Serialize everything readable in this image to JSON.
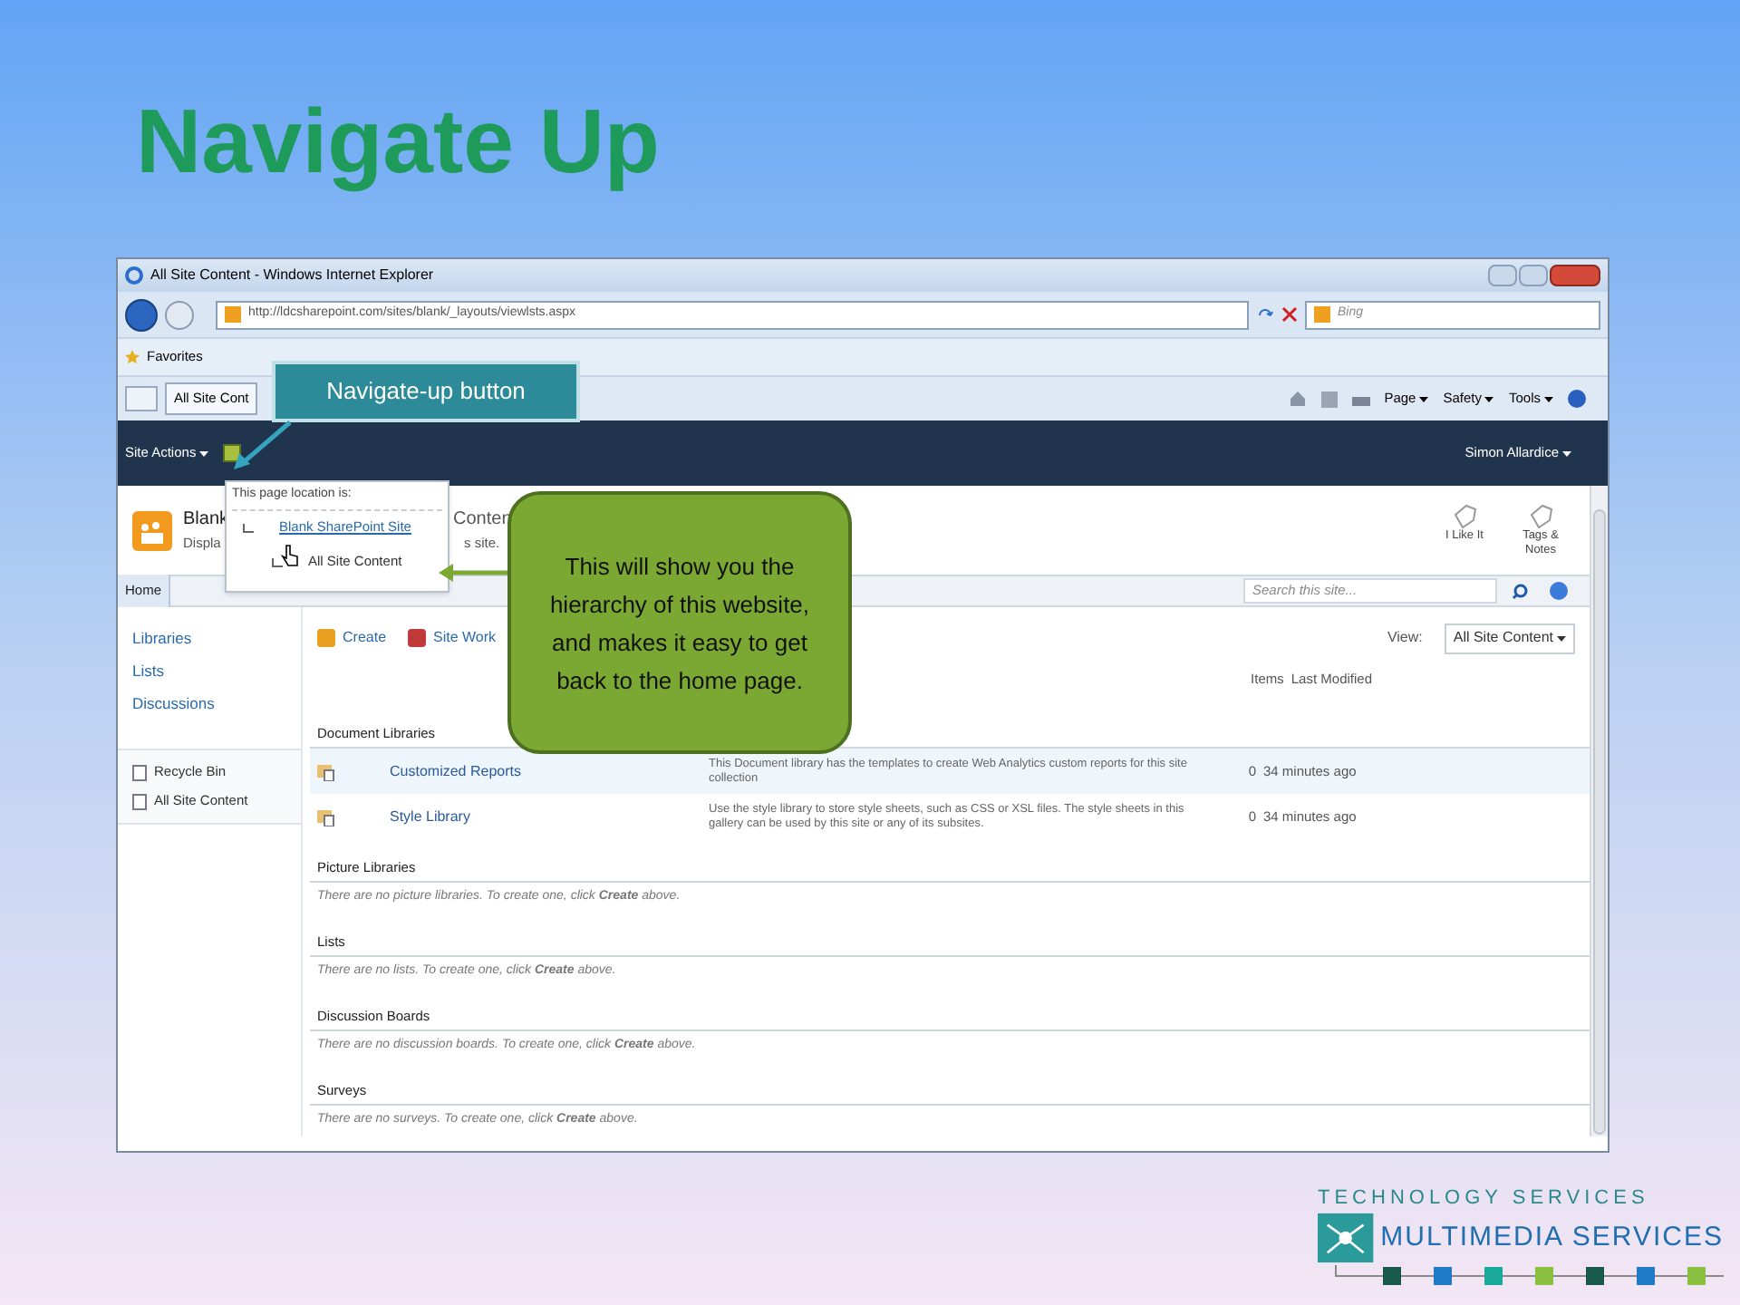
{
  "slide": {
    "title": "Navigate Up"
  },
  "browser": {
    "title": "All Site Content - Windows Internet Explorer",
    "address": "http://ldcsharepoint.com/sites/blank/_layouts/viewlsts.aspx",
    "search": {
      "placeholder": "Bing"
    },
    "favorites": "Favorites",
    "tab": "All Site Cont",
    "commands": [
      "Page",
      "Safety",
      "Tools"
    ]
  },
  "sharepoint": {
    "site_actions": "Site Actions",
    "user": "Simon Allardice",
    "site_title": "Blank",
    "site_title_tail": "Conten",
    "description": "Displa",
    "description_tail": "s site.",
    "social": [
      {
        "label": "I Like It"
      },
      {
        "label": "Tags & Notes"
      }
    ],
    "home_tab": "Home",
    "search": {
      "placeholder": "Search this site..."
    },
    "quick_launch": [
      "Libraries",
      "Lists",
      "Discussions"
    ],
    "quick_launch_footer": [
      "Recycle Bin",
      "All Site Content"
    ],
    "toolbar": [
      "Create",
      "Site Work"
    ],
    "view_label": "View:",
    "view_value": "All Site Content",
    "columns": [
      "Items",
      "Last Modified"
    ],
    "sections": [
      {
        "title": "Document Libraries",
        "rows": [
          {
            "name": "Customized Reports",
            "description": "This Document library has the templates to create Web Analytics custom reports for this site collection",
            "items": "0",
            "modified": "34 minutes ago",
            "selected": true
          },
          {
            "name": "Style Library",
            "description": "Use the style library to store style sheets, such as CSS or XSL files. The style sheets in this gallery can be used by this site or any of its subsites.",
            "items": "0",
            "modified": "34 minutes ago",
            "selected": false
          }
        ]
      },
      {
        "title": "Picture Libraries",
        "empty": "There are no picture libraries. To create one, click **Create** above."
      },
      {
        "title": "Lists",
        "empty": "There are no lists. To create one, click **Create** above."
      },
      {
        "title": "Discussion Boards",
        "empty": "There are no discussion boards. To create one, click **Create** above."
      },
      {
        "title": "Surveys",
        "empty": "There are no surveys. To create one, click **Create** above."
      }
    ]
  },
  "popup": {
    "heading": "This page location is:",
    "hierarchy": [
      {
        "label": "Blank SharePoint Site",
        "children": [
          {
            "label": "All Site Content"
          }
        ]
      }
    ]
  },
  "callouts": {
    "button_label": "Navigate-up button",
    "explanation": "This will show you the hierarchy of this website, and makes it easy to get back to the home page."
  },
  "logo": {
    "line1": "TECHNOLOGY SERVICES",
    "line2": "MULTIMEDIA SERVICES"
  }
}
